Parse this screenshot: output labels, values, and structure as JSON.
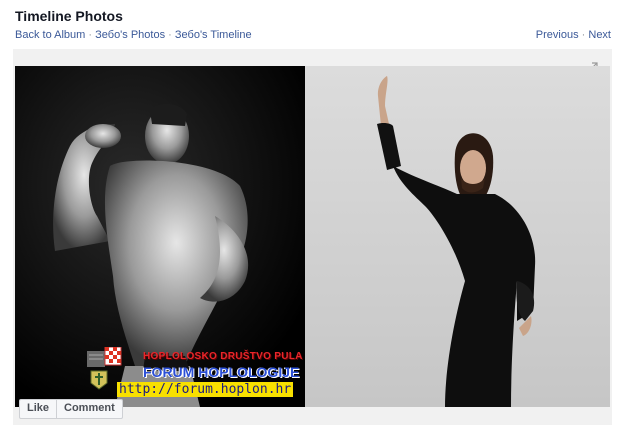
{
  "header": {
    "title": "Timeline Photos",
    "breadcrumb": [
      {
        "label": "Back to Album"
      },
      {
        "label": "Зебо's Photos"
      },
      {
        "label": "Зебо's Timeline"
      }
    ],
    "separator": "·",
    "pager": {
      "previous": "Previous",
      "next": "Next"
    }
  },
  "photo": {
    "watermark": {
      "line1": "HOPLOLOSKO DRUŠTVO PULA",
      "line2": "FORUM HOPLOLOGIJE",
      "url": "http://forum.hoplon.hr"
    }
  },
  "actions": {
    "like": "Like",
    "comment": "Comment"
  },
  "colors": {
    "link": "#3b5998",
    "title": "#141823",
    "stage_bg": "#f1f1f1"
  },
  "icons": {
    "expand": "expand-icon",
    "badge": "club-crest-icon"
  }
}
